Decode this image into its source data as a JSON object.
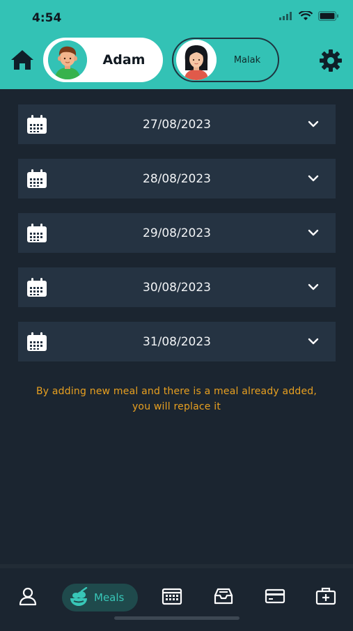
{
  "status": {
    "time": "4:54"
  },
  "header": {
    "profiles": [
      {
        "name": "Adam",
        "active": true
      },
      {
        "name": "Malak",
        "active": false
      }
    ]
  },
  "dates": [
    {
      "label": "27/08/2023"
    },
    {
      "label": "28/08/2023"
    },
    {
      "label": "29/08/2023"
    },
    {
      "label": "30/08/2023"
    },
    {
      "label": "31/08/2023"
    }
  ],
  "notice": "By adding new meal and there is a meal already added, you will replace it",
  "tabbar": {
    "items": [
      {
        "icon": "person-icon"
      },
      {
        "icon": "meal-icon",
        "label": "Meals",
        "selected": true
      },
      {
        "icon": "calendar-icon"
      },
      {
        "icon": "inbox-tray-icon"
      },
      {
        "icon": "card-icon"
      },
      {
        "icon": "medical-kit-icon"
      }
    ]
  },
  "colors": {
    "accent": "#33c2b5",
    "background": "#1b2530",
    "row": "#253342",
    "notice": "#e8a020"
  }
}
